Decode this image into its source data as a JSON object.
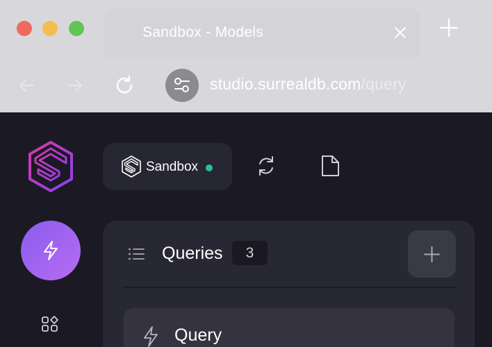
{
  "browser": {
    "tab_title": "Sandbox - Models",
    "url_host": "studio.surrealdb.com",
    "url_path": "/query"
  },
  "app": {
    "environment": {
      "name": "Sandbox",
      "status_color": "#26c09f"
    },
    "queries_panel": {
      "title": "Queries",
      "count": "3",
      "items": [
        {
          "label": "Query"
        }
      ]
    },
    "icons": {
      "logo": "surrealdb-logo",
      "sidebar_active": "lightning-icon",
      "sidebar_next": "grid-shapes-icon",
      "sync": "sync-icon",
      "file": "file-icon",
      "list": "list-icon",
      "add": "plus-icon"
    },
    "accent_color": "#8a5cf0"
  }
}
